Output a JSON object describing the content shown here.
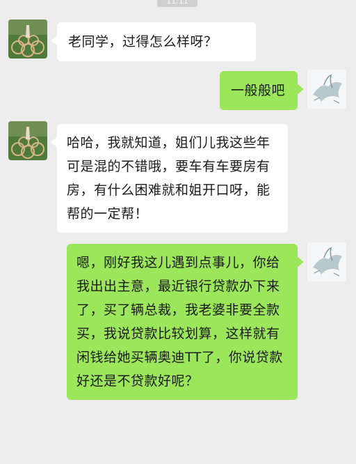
{
  "status": {
    "time": "11:11"
  },
  "colors": {
    "background": "#ededed",
    "incoming_bubble": "#ffffff",
    "outgoing_bubble": "#9be65a"
  },
  "messages": [
    {
      "sender": "friend",
      "avatar": "friend-avatar-icon",
      "text": "老同学，过得怎么样呀？"
    },
    {
      "sender": "me",
      "avatar": "my-avatar-icon",
      "text": "一般般吧"
    },
    {
      "sender": "friend",
      "avatar": "friend-avatar-icon",
      "text": "哈哈，我就知道，姐们儿我这些年可是混的不错哦，要车有车要房有房，有什么困难就和姐开口呀，能帮的一定帮！"
    },
    {
      "sender": "me",
      "avatar": "my-avatar-icon",
      "text": "嗯，刚好我这儿遇到点事儿，你给我出出主意，最近银行贷款办下来了，买了辆总裁，我老婆非要全款买，我说贷款比较划算，这样就有闲钱给她买辆奥迪TT了，你说贷款好还是不贷款好呢？"
    }
  ]
}
